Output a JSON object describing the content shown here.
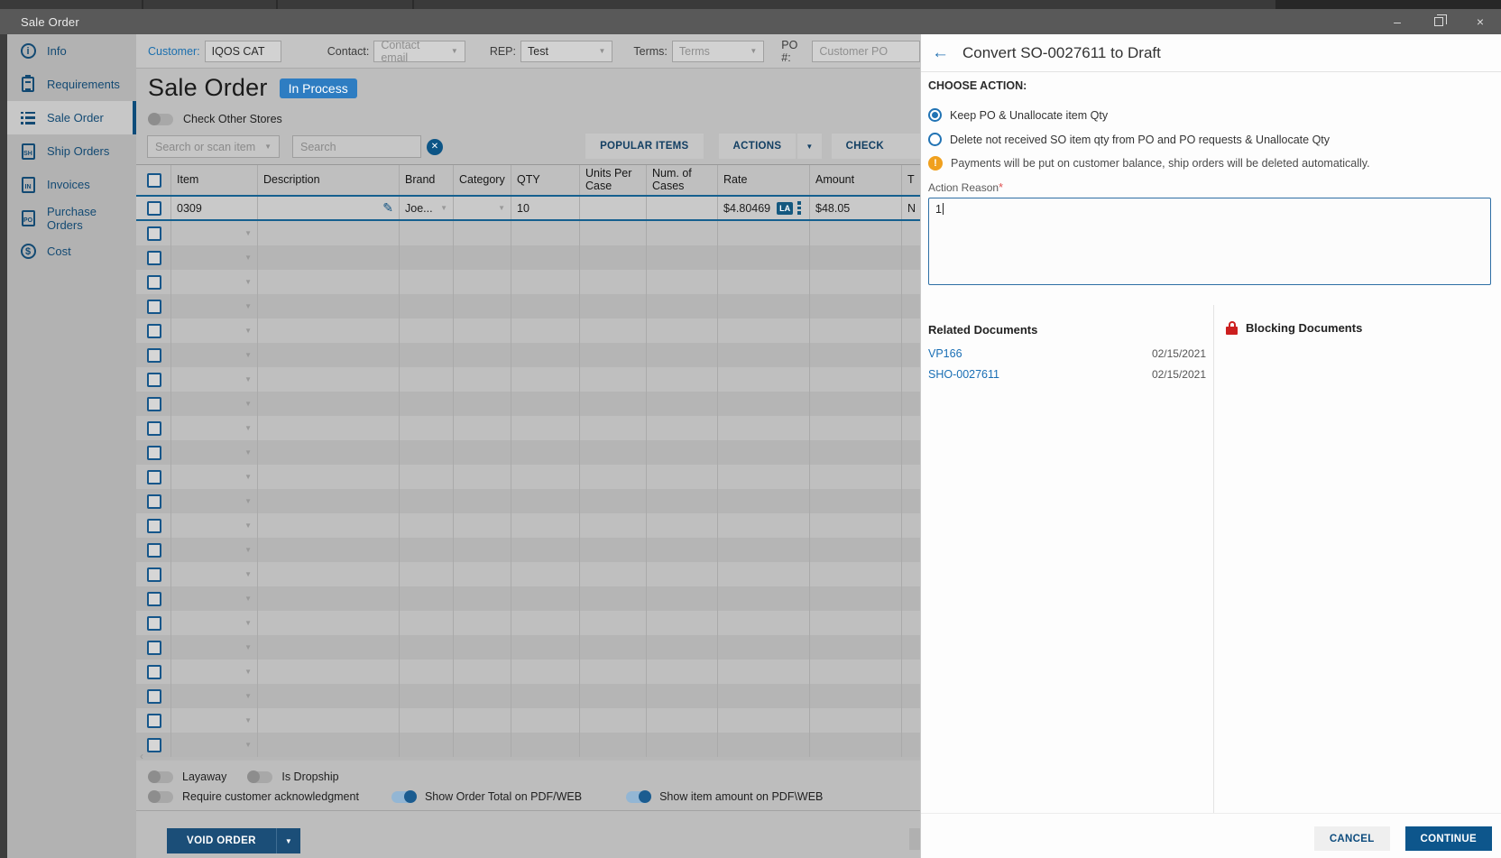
{
  "titlebar": {
    "title": "Sale Order",
    "minimize_glyph": "–",
    "close_glyph": "×"
  },
  "sidebar": {
    "active": "Sale Order",
    "items": [
      {
        "label": "Info",
        "icon": "info-icon",
        "glyph": "i"
      },
      {
        "label": "Requirements",
        "icon": "clipboard-icon",
        "glyph": ""
      },
      {
        "label": "Sale Order",
        "icon": "list-icon",
        "glyph": ""
      },
      {
        "label": "Ship Orders",
        "icon": "ship-doc-icon",
        "glyph": "SH"
      },
      {
        "label": "Invoices",
        "icon": "invoice-doc-icon",
        "glyph": "IN"
      },
      {
        "label": "Purchase Orders",
        "icon": "po-doc-icon",
        "glyph": "PO"
      },
      {
        "label": "Cost",
        "icon": "dollar-icon",
        "glyph": "$"
      }
    ]
  },
  "fields": {
    "customer": {
      "label": "Customer:",
      "value": "IQOS CAT"
    },
    "contact": {
      "label": "Contact:",
      "placeholder": "Contact email"
    },
    "rep": {
      "label": "REP:",
      "value": "Test"
    },
    "terms": {
      "label": "Terms:",
      "placeholder": "Terms"
    },
    "po": {
      "label": "PO #:",
      "placeholder": "Customer PO"
    }
  },
  "order_header": {
    "title": "Sale Order",
    "status": "In Process",
    "check_other_stores": "Check Other Stores"
  },
  "search": {
    "scan_placeholder": "Search or scan item",
    "search_placeholder": "Search",
    "clear_glyph": "✕"
  },
  "toolbar": {
    "popular": "POPULAR ITEMS",
    "actions": "ACTIONS",
    "caret_glyph": "▼",
    "check": "CHECK"
  },
  "table": {
    "columns": [
      "Item",
      "Description",
      "Brand",
      "Category",
      "QTY",
      "Units Per Case",
      "Num. of Cases",
      "Rate",
      "Amount",
      "T"
    ],
    "row": {
      "item": "0309",
      "brand": "Joe...",
      "qty": "10",
      "rate": "$4.80469",
      "rate_badge": "LA",
      "amount": "$48.05",
      "tax_fragment": "N",
      "pencil_glyph": "✎"
    },
    "empty_rows": 22,
    "caret_glyph": "▼",
    "scroll_left_glyph": "‹"
  },
  "footer": {
    "toggles": [
      {
        "label": "Layaway",
        "on": false
      },
      {
        "label": "Is Dropship",
        "on": false
      },
      {
        "label": "Require customer acknowledgment",
        "on": false
      },
      {
        "label": "Show Order Total on PDF/WEB",
        "on": true
      },
      {
        "label": "Show item amount on PDF\\WEB",
        "on": true
      }
    ],
    "void_button": "VOID ORDER"
  },
  "panel": {
    "back_glyph": "←",
    "title": "Convert SO-0027611 to Draft",
    "choose_action": "CHOOSE ACTION:",
    "options": [
      {
        "label": "Keep PO & Unallocate item Qty",
        "selected": true
      },
      {
        "label": "Delete not received SO item qty from PO and PO requests & Unallocate Qty",
        "selected": false
      }
    ],
    "warning_glyph": "!",
    "warning": "Payments will be put on customer balance, ship orders will be deleted automatically.",
    "action_reason": {
      "label": "Action Reason",
      "required_mark": "*",
      "value": "1"
    },
    "related": {
      "title": "Related Documents",
      "docs": [
        {
          "name": "VP166",
          "date": "02/15/2021"
        },
        {
          "name": "SHO-0027611",
          "date": "02/15/2021"
        }
      ]
    },
    "blocking": {
      "title": "Blocking Documents"
    },
    "cancel": "CANCEL",
    "continue": "CONTINUE"
  }
}
